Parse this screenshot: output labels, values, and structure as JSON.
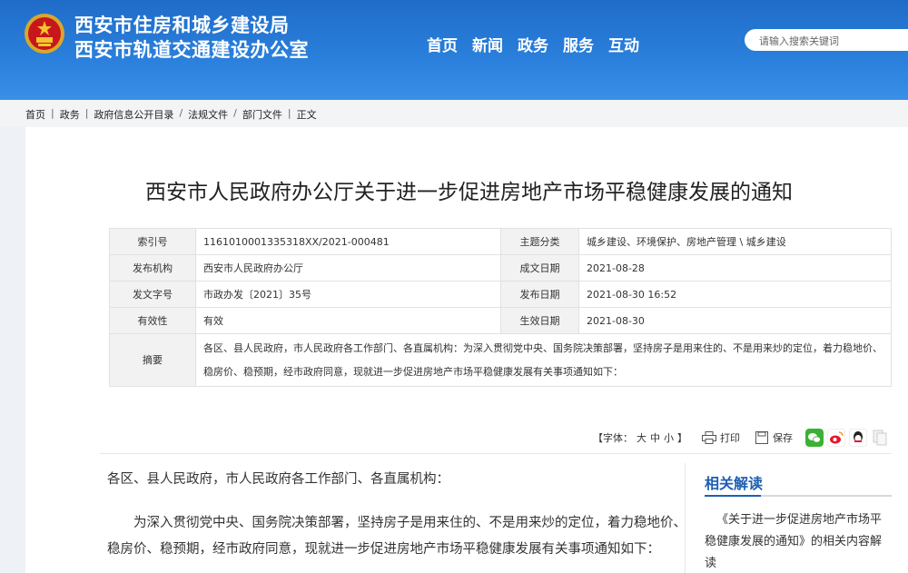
{
  "header": {
    "site_name_line1": "西安市住房和城乡建设局",
    "site_name_line2": "西安市轨道交通建设办公室",
    "nav": [
      "首页",
      "新闻",
      "政务",
      "服务",
      "互动"
    ],
    "search_placeholder": "请输入搜索关键词"
  },
  "breadcrumb": [
    "首页",
    "政务",
    "政府信息公开目录",
    "法规文件",
    "部门文件",
    "正文"
  ],
  "article": {
    "title": "西安市人民政府办公厅关于进一步促进房地产市场平稳健康发展的通知",
    "meta": {
      "index_label": "索引号",
      "index_value": "1161010001335318XX/2021-000481",
      "topic_label": "主题分类",
      "topic_value": "城乡建设、环境保护、房地产管理 \\ 城乡建设",
      "issuer_label": "发布机构",
      "issuer_value": "西安市人民政府办公厅",
      "created_label": "成文日期",
      "created_value": "2021-08-28",
      "docno_label": "发文字号",
      "docno_value": "市政办发〔2021〕35号",
      "published_label": "发布日期",
      "published_value": "2021-08-30 16:52",
      "validity_label": "有效性",
      "validity_value": "有效",
      "effective_label": "生效日期",
      "effective_value": "2021-08-30",
      "abstract_label": "摘要",
      "abstract_value": "各区、县人民政府，市人民政府各工作部门、各直属机构：为深入贯彻党中央、国务院决策部署，坚持房子是用来住的、不是用来炒的定位，着力稳地价、稳房价、稳预期，经市政府同意，现就进一步促进房地产市场平稳健康发展有关事项通知如下："
    },
    "tools": {
      "font_label": "【字体：",
      "font_large": "大",
      "font_medium": "中",
      "font_small": "小",
      "font_close": "】",
      "print_label": "打印",
      "save_label": "保存"
    },
    "paragraph1": "各区、县人民政府，市人民政府各工作部门、各直属机构：",
    "paragraph2": "为深入贯彻党中央、国务院决策部署，坚持房子是用来住的、不是用来炒的定位，着力稳地价、稳房价、稳预期，经市政府同意，现就进一步促进房地产市场平稳健康发展有关事项通知如下："
  },
  "related": {
    "title": "相关解读",
    "item": "《关于进一步促进房地产市场平稳健康发展的通知》的相关内容解读"
  },
  "colors": {
    "header_blue": "#2a80dc",
    "accent_blue": "#1e5fb3"
  }
}
